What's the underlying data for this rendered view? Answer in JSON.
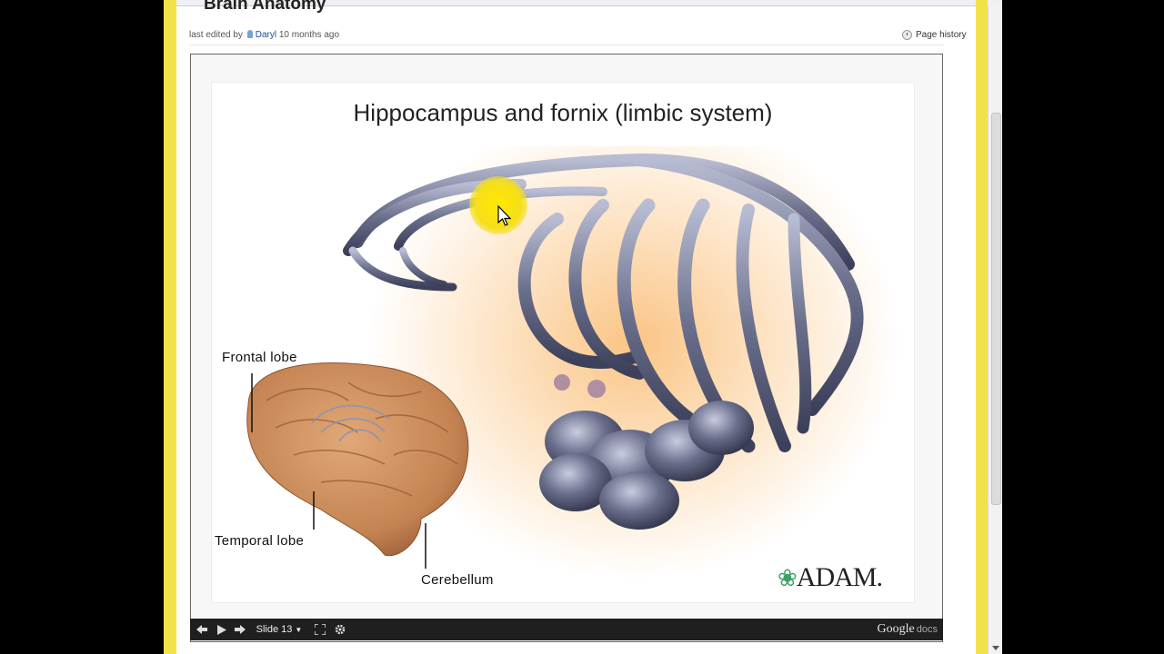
{
  "page": {
    "heading": "Brain Anatomy",
    "last_edited_prefix": "last edited by",
    "editor": "Daryl",
    "edited_time": "10 months ago",
    "history_label": "Page history"
  },
  "slide": {
    "title": "Hippocampus and fornix (limbic system)",
    "labels": {
      "frontal": "Frontal lobe",
      "temporal": "Temporal lobe",
      "cerebellum": "Cerebellum"
    },
    "logo_text": "ADAM.",
    "logo_icon": "leaf-icon"
  },
  "controls": {
    "slide_label": "Slide 13",
    "brand": "Google",
    "brand_suffix": "docs",
    "icons": [
      "prev-icon",
      "play-icon",
      "next-icon",
      "fullscreen-icon",
      "gear-icon"
    ]
  },
  "colors": {
    "highlight": "#f2e24a",
    "control_bar": "#1f1f1f",
    "fornix": "#6a6f8c",
    "brain": "#c98a5a"
  }
}
